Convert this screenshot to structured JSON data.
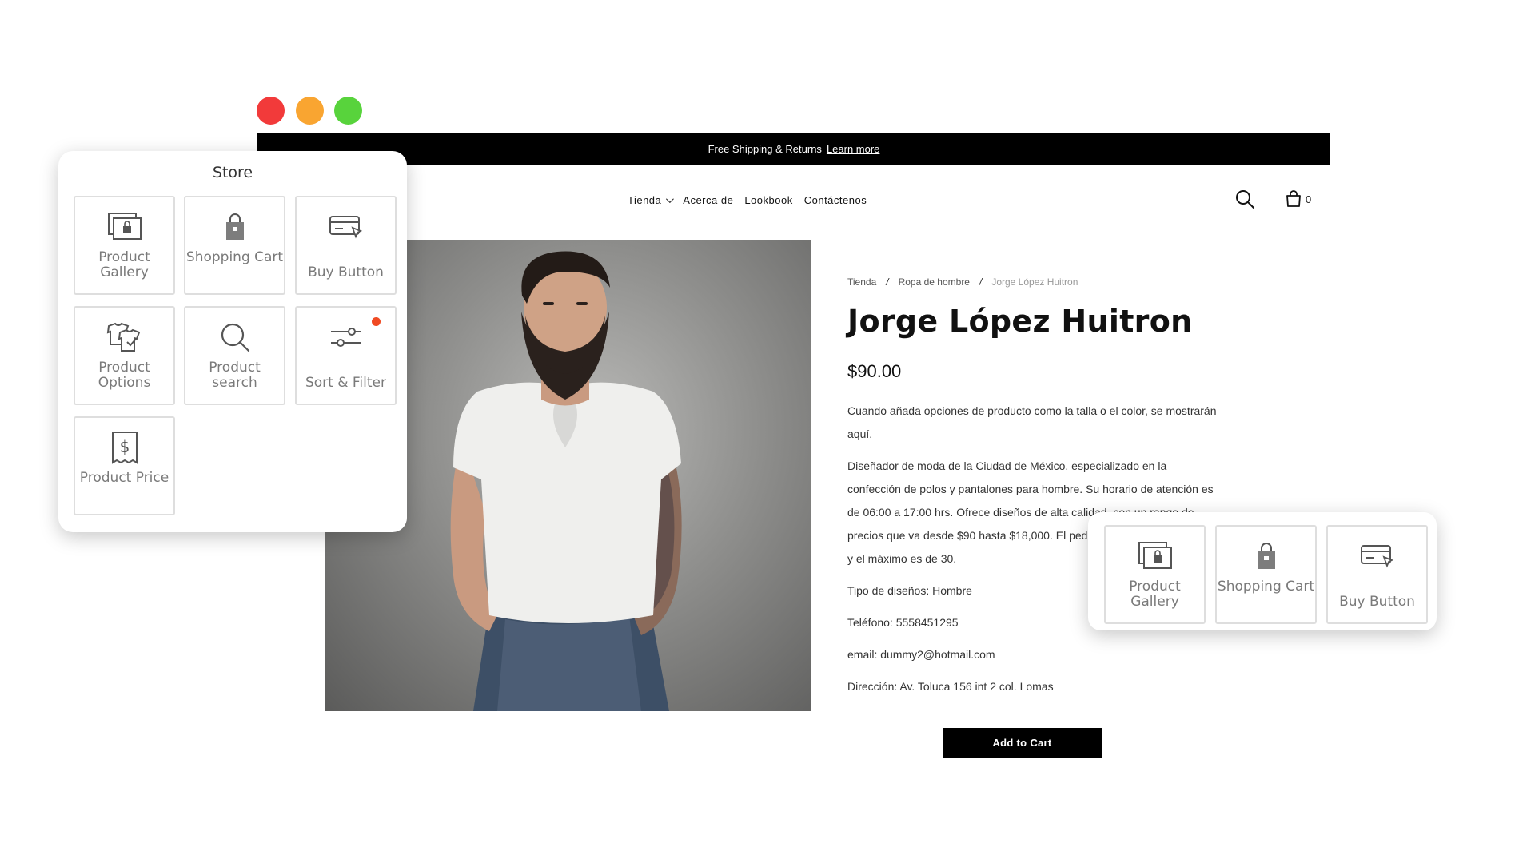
{
  "window": {
    "controls": [
      "close",
      "minimize",
      "maximize"
    ]
  },
  "announcement": {
    "text": "Free Shipping & Returns",
    "link": "Learn more"
  },
  "nav": {
    "items": [
      {
        "label": "Tienda"
      },
      {
        "label": "Acerca de"
      },
      {
        "label": "Lookbook"
      },
      {
        "label": "Contáctenos"
      }
    ],
    "cart_count": "0"
  },
  "breadcrumb": {
    "items": [
      "Tienda",
      "Ropa de hombre",
      "Jorge López Huitron"
    ],
    "separator": "/"
  },
  "product": {
    "title": "Jorge López Huitron",
    "price": "$90.00",
    "paragraphs": [
      "Cuando añada opciones de producto como la talla o el color, se mostrarán aquí.",
      "Diseñador de moda de la Ciudad de México, especializado en la confección de polos y pantalones para hombre. Su horario de atención es de 06:00 a 17:00 hrs. Ofrece diseños de alta calidad, con un rango de precios que va desde $90 hasta $18,000. El pedido mínimo es de 1 prenda y el máximo es de 30.",
      "Tipo de diseños: Hombre",
      "Teléfono: 5558451295",
      "email: dummy2@hotmail.com",
      "Dirección: Av. Toluca 156 int 2 col. Lomas"
    ],
    "add_to_cart": "Add to Cart"
  },
  "store_panel": {
    "title": "Store",
    "tiles": [
      {
        "label": "Product Gallery",
        "icon": "product-gallery-icon"
      },
      {
        "label": "Shopping Cart",
        "icon": "shopping-bag-icon"
      },
      {
        "label": "Buy Button",
        "icon": "credit-card-click-icon"
      },
      {
        "label": "Product Options",
        "icon": "product-options-icon"
      },
      {
        "label": "Product search",
        "icon": "search-icon"
      },
      {
        "label": "Sort & Filter",
        "icon": "sliders-icon",
        "notification": true
      },
      {
        "label": "Product Price",
        "icon": "price-tag-icon"
      }
    ]
  },
  "mini_panel": {
    "tiles": [
      {
        "label": "Product Gallery",
        "icon": "product-gallery-icon"
      },
      {
        "label": "Shopping Cart",
        "icon": "shopping-bag-icon"
      },
      {
        "label": "Buy Button",
        "icon": "credit-card-click-icon"
      }
    ]
  },
  "colors": {
    "close": "#f23a3a",
    "minimize": "#f9a531",
    "maximize": "#58d33c",
    "notification": "#f04a23",
    "topbar": "#000000"
  }
}
